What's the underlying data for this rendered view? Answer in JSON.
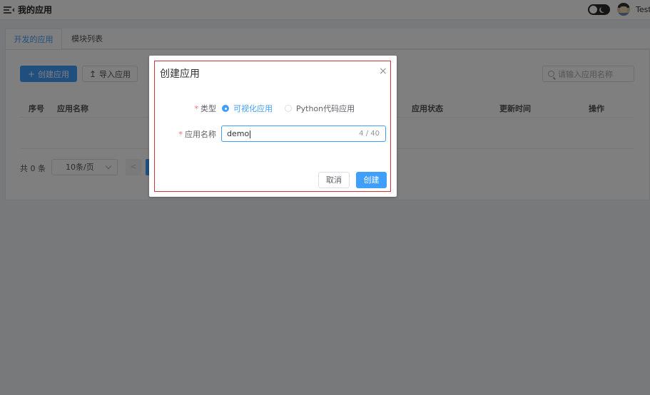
{
  "header": {
    "title": "我的应用",
    "user_name": "Test"
  },
  "tabs": [
    {
      "label": "开发的应用",
      "active": true
    },
    {
      "label": "模块列表",
      "active": false
    }
  ],
  "toolbar": {
    "create_label": "创建应用",
    "import_label": "导入应用",
    "search_placeholder": "请输入应用名称"
  },
  "table": {
    "columns": [
      "序号",
      "应用名称",
      "应用状态",
      "更新时间",
      "操作"
    ],
    "rows": []
  },
  "pagination": {
    "total_text": "共 0 条",
    "page_size": "10条/页",
    "prev": "<"
  },
  "modal": {
    "title": "创建应用",
    "type_label": "类型",
    "type_options": [
      {
        "label": "可视化应用",
        "selected": true
      },
      {
        "label": "Python代码应用",
        "selected": false
      }
    ],
    "name_label": "应用名称",
    "name_value": "demo",
    "name_counter": "4 / 40",
    "cancel_label": "取消",
    "confirm_label": "创建",
    "close_glyph": "×"
  },
  "colors": {
    "primary": "#409eff",
    "required": "#f56c6c",
    "highlight": "#d0343f",
    "overlay": "rgba(0,0,0,0.5)"
  }
}
